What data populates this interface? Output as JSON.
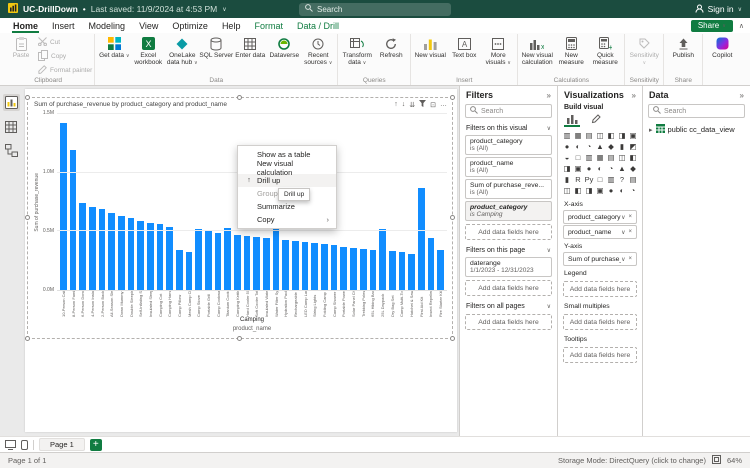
{
  "titlebar": {
    "title": "UC-DrillDown",
    "separator": "•",
    "last_saved": "Last saved: 11/9/2024 at 4:53 PM",
    "search_placeholder": "Search",
    "sign_in": "Sign in"
  },
  "ribbon_tabs": {
    "items": [
      "Home",
      "Insert",
      "Modeling",
      "View",
      "Optimize",
      "Help",
      "Format",
      "Data / Drill"
    ],
    "active": "Home",
    "contextual": [
      "Format",
      "Data / Drill"
    ],
    "share_label": "Share"
  },
  "ribbon": {
    "groups": [
      {
        "label": "Clipboard",
        "paste": {
          "label": "Paste",
          "icon": "paste",
          "disabled": true
        },
        "small": [
          {
            "label": "Cut",
            "icon": "scissors",
            "disabled": true
          },
          {
            "label": "Copy",
            "icon": "copy",
            "disabled": true
          },
          {
            "label": "Format painter",
            "icon": "brush",
            "disabled": true
          }
        ]
      },
      {
        "label": "Data",
        "buttons": [
          {
            "label": "Get data",
            "icon": "get-data",
            "dropdown": true
          },
          {
            "label": "Excel workbook",
            "icon": "excel"
          },
          {
            "label": "OneLake data hub",
            "icon": "onelake",
            "dropdown": true
          },
          {
            "label": "SQL Server",
            "icon": "database"
          },
          {
            "label": "Enter data",
            "icon": "table"
          },
          {
            "label": "Dataverse",
            "icon": "dataverse"
          },
          {
            "label": "Recent sources",
            "icon": "clock",
            "dropdown": true
          }
        ]
      },
      {
        "label": "Queries",
        "buttons": [
          {
            "label": "Transform data",
            "icon": "transform",
            "dropdown": true
          },
          {
            "label": "Refresh",
            "icon": "refresh"
          }
        ]
      },
      {
        "label": "Insert",
        "buttons": [
          {
            "label": "New visual",
            "icon": "new-visual"
          },
          {
            "label": "Text box",
            "icon": "text-box"
          },
          {
            "label": "More visuals",
            "icon": "more-visuals",
            "dropdown": true
          }
        ]
      },
      {
        "label": "Calculations",
        "buttons": [
          {
            "label": "New visual calculation",
            "icon": "visual-calc"
          },
          {
            "label": "New measure",
            "icon": "measure"
          },
          {
            "label": "Quick measure",
            "icon": "quick-measure"
          }
        ]
      },
      {
        "label": "Sensitivity",
        "buttons": [
          {
            "label": "Sensitivity",
            "icon": "sensitivity",
            "dropdown": true,
            "disabled": true
          }
        ]
      },
      {
        "label": "Share",
        "buttons": [
          {
            "label": "Publish",
            "icon": "publish"
          }
        ]
      },
      {
        "label": "",
        "buttons": [
          {
            "label": "Copilot",
            "icon": "copilot"
          }
        ]
      }
    ]
  },
  "left_rail": {
    "items": [
      {
        "name": "report-view",
        "active": true
      },
      {
        "name": "table-view",
        "active": false
      },
      {
        "name": "model-view",
        "active": false
      }
    ]
  },
  "chart_header_icons": [
    {
      "name": "drill-up-icon",
      "glyph": "↑"
    },
    {
      "name": "drill-down-icon",
      "glyph": "↓"
    },
    {
      "name": "expand-next-level-icon",
      "glyph": "⇊"
    },
    {
      "name": "filters-icon",
      "glyph": "funnel"
    },
    {
      "name": "focus-mode-icon",
      "glyph": "⊡"
    },
    {
      "name": "more-options-icon",
      "glyph": "…"
    }
  ],
  "chart_data": {
    "type": "bar",
    "title": "Sum of purchase_revenue by product_category and product_name",
    "ylabel": "Sum of purchase_revenue",
    "xlabel": "product_name",
    "category_label": "Camping",
    "bar_color": "#118DFF",
    "ymax": 1.5,
    "yticks": [
      {
        "v": 0,
        "label": "0.0M"
      },
      {
        "v": 0.5,
        "label": "0.5M"
      },
      {
        "v": 1.0,
        "label": "1.0M"
      },
      {
        "v": 1.5,
        "label": "1.5M"
      }
    ],
    "categories": [
      "10-Person Cabin Tent",
      "8-Person Family Tent",
      "6-Person Dome Tent",
      "4-Person Instant Tent",
      "2-Person Backpacking Tent",
      "All-Season Sleeping Bag",
      "Down Mummy Sleeping Bag",
      "Double Sleeping Bag",
      "Self-Inflating Sleeping Pad",
      "Insulated Sleeping Pad",
      "Camping Cot",
      "Camping Hammock",
      "Camp Pillow",
      "Mesh Camp Chair",
      "Camp Stove",
      "Portable Grill",
      "Camp Cookware Set",
      "Titanium Cook Pot",
      "Camping Kettle",
      "Hard Cooler 50qt",
      "Soft Cooler Tote",
      "Insulated Water Bottle",
      "Water Filter System",
      "Hydration Pack",
      "Rechargeable Headlamp",
      "LED Camp Lantern",
      "String Lights",
      "Folding Camp Table",
      "Camp Shower Kit",
      "Portable Power Station",
      "Solar Panel Charger",
      "Trekking Poles",
      "65L Hiking Backpack",
      "25L Daypack",
      "Dry Bag Set",
      "Camp Multi-Tool",
      "Hatchet & Saw Kit",
      "First Aid Kit",
      "Insect Repellent Kit",
      "Fire Starter Kit"
    ],
    "values": [
      1.42,
      1.19,
      0.74,
      0.71,
      0.69,
      0.66,
      0.63,
      0.61,
      0.59,
      0.57,
      0.56,
      0.54,
      0.34,
      0.32,
      0.52,
      0.5,
      0.49,
      0.53,
      0.47,
      0.46,
      0.45,
      0.44,
      0.56,
      0.43,
      0.42,
      0.41,
      0.4,
      0.39,
      0.38,
      0.37,
      0.36,
      0.35,
      0.34,
      0.52,
      0.33,
      0.32,
      0.31,
      0.87,
      0.44,
      0.34
    ]
  },
  "context_menu": {
    "items": [
      {
        "label": "Show as a table"
      },
      {
        "label": "New visual calculation"
      },
      {
        "label": "Drill up",
        "icon": "drill-up",
        "state": "hover"
      },
      {
        "label": "Group",
        "disabled": true
      },
      {
        "label": "Summarize"
      },
      {
        "label": "Copy",
        "submenu": true
      }
    ],
    "tooltip": "Drill up"
  },
  "filters": {
    "header": "Filters",
    "search_placeholder": "Search",
    "add_placeholder": "Add data fields here",
    "sections": [
      {
        "title": "Filters on this visual",
        "cards": [
          {
            "name": "product_category",
            "cond": "is (All)"
          },
          {
            "name": "product_name",
            "cond": "is (All)"
          },
          {
            "name": "Sum of purchase_reve...",
            "cond": "is (All)"
          },
          {
            "name": "product_category",
            "cond": "is Camping",
            "drill": true
          }
        ]
      },
      {
        "title": "Filters on this page",
        "cards": [
          {
            "name": "daterange",
            "cond": "1/1/2023 - 12/31/2023"
          }
        ]
      },
      {
        "title": "Filters on all pages",
        "cards": []
      }
    ]
  },
  "visualizations": {
    "header": "Visualizations",
    "subheader": "Build visual",
    "add_placeholder": "Add data fields here",
    "icons": [
      "stacked-bar-chart",
      "stacked-column-chart",
      "clustered-bar-chart",
      "clustered-column-chart",
      "100-stacked-bar-chart",
      "100-stacked-column-chart",
      "line-chart",
      "area-chart",
      "stacked-area-chart",
      "line-and-stacked-column-chart",
      "line-and-clustered-column-chart",
      "ribbon-chart",
      "waterfall-chart",
      "funnel-chart",
      "scatter-chart",
      "pie-chart",
      "donut-chart",
      "treemap",
      "map",
      "filled-map",
      "shape-map",
      "azure-map",
      "gauge",
      "card",
      "multi-row-card",
      "kpi",
      "slicer",
      "table",
      "matrix",
      "r-script-visual",
      "python-visual",
      "key-influencers",
      "decomposition-tree",
      "q-and-a",
      "smart-narrative",
      "metrics",
      "paginated-report",
      "arcgis-map",
      "power-apps",
      "power-automate",
      "button-visual",
      "text-slicer"
    ],
    "wells": [
      {
        "label": "X-axis",
        "fields": [
          {
            "name": "product_category"
          },
          {
            "name": "product_name"
          }
        ]
      },
      {
        "label": "Y-axis",
        "fields": [
          {
            "name": "Sum of purchase_reve..."
          }
        ]
      },
      {
        "label": "Legend",
        "fields": []
      },
      {
        "label": "Small multiples",
        "fields": []
      },
      {
        "label": "Tooltips",
        "fields": []
      }
    ]
  },
  "data_pane": {
    "header": "Data",
    "search_placeholder": "Search",
    "items": [
      {
        "label": "public cc_data_view",
        "icon": "green-table"
      }
    ]
  },
  "page_bar": {
    "page_tab": "Page 1",
    "add_page": "+"
  },
  "status_bar": {
    "page_indicator": "Page 1 of 1",
    "storage_mode": "Storage Mode: DirectQuery (click to change)",
    "zoom": "64%"
  }
}
